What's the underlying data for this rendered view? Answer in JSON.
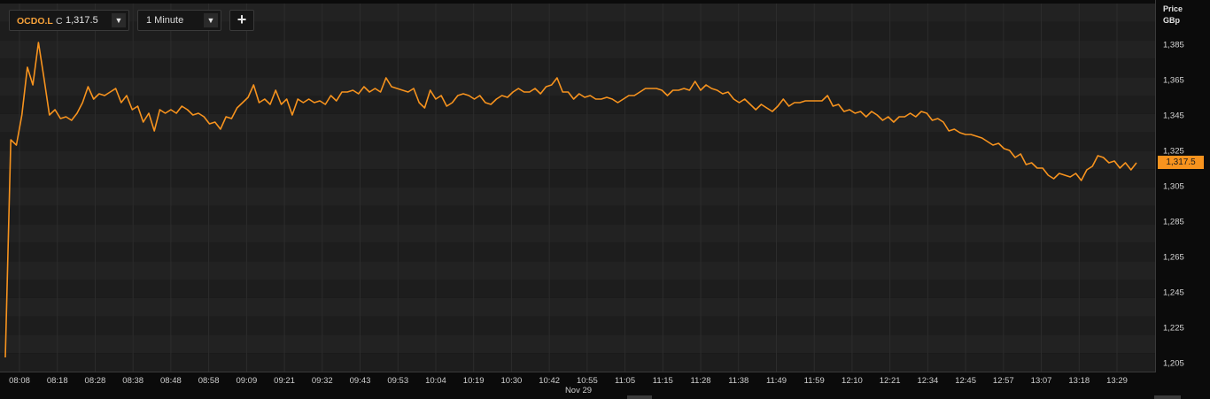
{
  "toolbar": {
    "ric": "OCDO.L",
    "close_prefix": "C",
    "close_value": "1,317.5",
    "ric_dropdown_icon": "triangle-down-icon",
    "interval": "1 Minute",
    "interval_dropdown_icon": "triangle-down-icon",
    "add_label": "+"
  },
  "axis": {
    "unit_line1": "Price",
    "unit_line2": "GBp",
    "last_badge": "1,317.5",
    "date_label": "Nov 29"
  },
  "colors": {
    "background": "#0b0b0b",
    "band_dark": "#1d1d1d",
    "band_light": "#222222",
    "line": "#f7931e",
    "badge": "#f7931e",
    "ric_text": "#f7a23a"
  },
  "chart_data": {
    "type": "line",
    "title": "",
    "xlabel": "",
    "ylabel": "Price GBp",
    "ylim": [
      1199,
      1397
    ],
    "y_ticks": [
      1205,
      1225,
      1245,
      1265,
      1285,
      1305,
      1325,
      1345,
      1365,
      1385
    ],
    "y_tick_labels": [
      "1,205",
      "1,225",
      "1,245",
      "1,265",
      "1,285",
      "1,305",
      "1,325",
      "1,345",
      "1,365",
      "1,385"
    ],
    "x_tick_labels": [
      "08:08",
      "08:18",
      "08:28",
      "08:38",
      "08:48",
      "08:58",
      "09:09",
      "09:21",
      "09:32",
      "09:43",
      "09:53",
      "10:04",
      "10:19",
      "10:30",
      "10:42",
      "10:55",
      "11:05",
      "11:15",
      "11:28",
      "11:38",
      "11:49",
      "11:59",
      "12:10",
      "12:21",
      "12:34",
      "12:45",
      "12:57",
      "13:07",
      "13:18",
      "13:29"
    ],
    "x_date": "Nov 29",
    "last_value": 1317.5,
    "series": [
      {
        "values": [
          1208,
          1331,
          1328,
          1345,
          1372,
          1362,
          1386,
          1366,
          1345,
          1348,
          1343,
          1344,
          1342,
          1346,
          1352,
          1361,
          1354,
          1357,
          1356,
          1358,
          1360,
          1352,
          1356,
          1348,
          1350,
          1341,
          1346,
          1336,
          1348,
          1346,
          1348,
          1346,
          1350,
          1348,
          1345,
          1346,
          1344,
          1340,
          1341,
          1337,
          1344,
          1343,
          1349,
          1352,
          1355,
          1362,
          1352,
          1354,
          1351,
          1359,
          1351,
          1354,
          1345,
          1354,
          1352,
          1354,
          1352,
          1353,
          1351,
          1356,
          1353,
          1358,
          1358,
          1359,
          1357,
          1361,
          1358,
          1360,
          1358,
          1366,
          1361,
          1360,
          1359,
          1358,
          1360,
          1352,
          1349,
          1359,
          1354,
          1356,
          1350,
          1352,
          1356,
          1357,
          1356,
          1354,
          1356,
          1352,
          1351,
          1354,
          1356,
          1355,
          1358,
          1360,
          1358,
          1358,
          1360,
          1357,
          1361,
          1362,
          1366,
          1358,
          1358,
          1354,
          1357,
          1355,
          1356,
          1354,
          1354,
          1355,
          1354,
          1352,
          1354,
          1356,
          1356,
          1358,
          1360,
          1360,
          1360,
          1359,
          1356,
          1359,
          1359,
          1360,
          1359,
          1364,
          1359,
          1362,
          1360,
          1359,
          1357,
          1358,
          1354,
          1352,
          1354,
          1351,
          1348,
          1351,
          1349,
          1347,
          1350,
          1354,
          1350,
          1352,
          1352,
          1353,
          1353,
          1353,
          1353,
          1356,
          1350,
          1351,
          1347,
          1348,
          1346,
          1347,
          1344,
          1347,
          1345,
          1342,
          1344,
          1341,
          1344,
          1344,
          1346,
          1344,
          1347,
          1346,
          1342,
          1343,
          1341,
          1336,
          1337,
          1335,
          1334,
          1334,
          1333,
          1332,
          1330,
          1328,
          1329,
          1326,
          1325,
          1321,
          1323,
          1317,
          1318,
          1315,
          1315,
          1311,
          1309,
          1312,
          1311,
          1310,
          1312,
          1308,
          1314,
          1316,
          1322,
          1321,
          1318,
          1319,
          1315,
          1318,
          1314,
          1318
        ]
      }
    ]
  }
}
